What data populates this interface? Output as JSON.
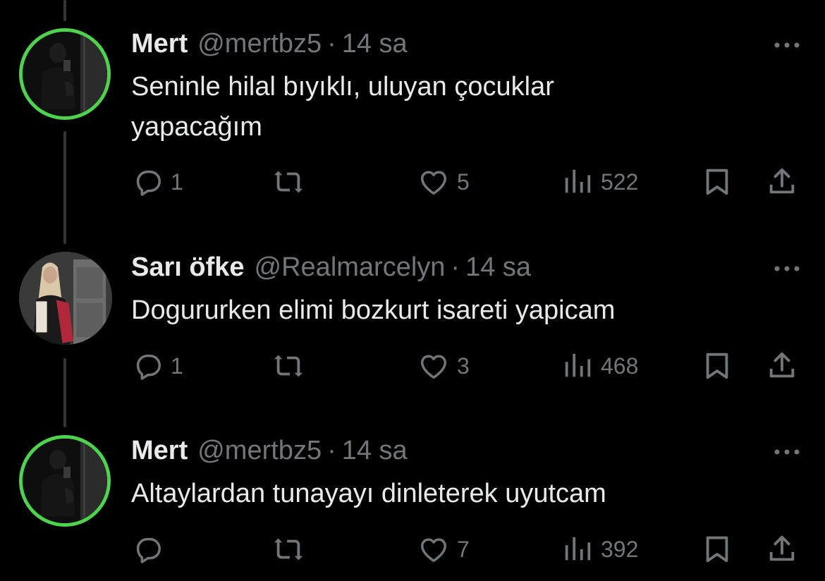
{
  "colors": {
    "background": "#000000",
    "text_primary": "#e7e9ea",
    "text_secondary": "#71767b",
    "avatar_ring": "#4cd44c",
    "thread_line": "#333639"
  },
  "tweets": [
    {
      "name": "Mert",
      "handle": "@mertbz5",
      "separator": "·",
      "time": "14 sa",
      "text": "Seninle hilal bıyıklı, uluyan çocuklar\nyapacağım",
      "reply_count": "1",
      "retweet_count": "",
      "like_count": "5",
      "view_count": "522"
    },
    {
      "name": "Sarı öfke",
      "handle": "@Realmarcelyn",
      "separator": "·",
      "time": "14 sa",
      "text": "Dogururken elimi bozkurt isareti yapicam",
      "reply_count": "1",
      "retweet_count": "",
      "like_count": "3",
      "view_count": "468"
    },
    {
      "name": "Mert",
      "handle": "@mertbz5",
      "separator": "·",
      "time": "14 sa",
      "text": "Altaylardan tunayayı dinleterek uyutcam",
      "reply_count": "",
      "retweet_count": "",
      "like_count": "7",
      "view_count": "392"
    }
  ],
  "icons": {
    "reply": "reply-icon",
    "retweet": "retweet-icon",
    "like": "heart-icon",
    "views": "views-icon",
    "bookmark": "bookmark-icon",
    "share": "share-icon",
    "more": "more-icon"
  }
}
